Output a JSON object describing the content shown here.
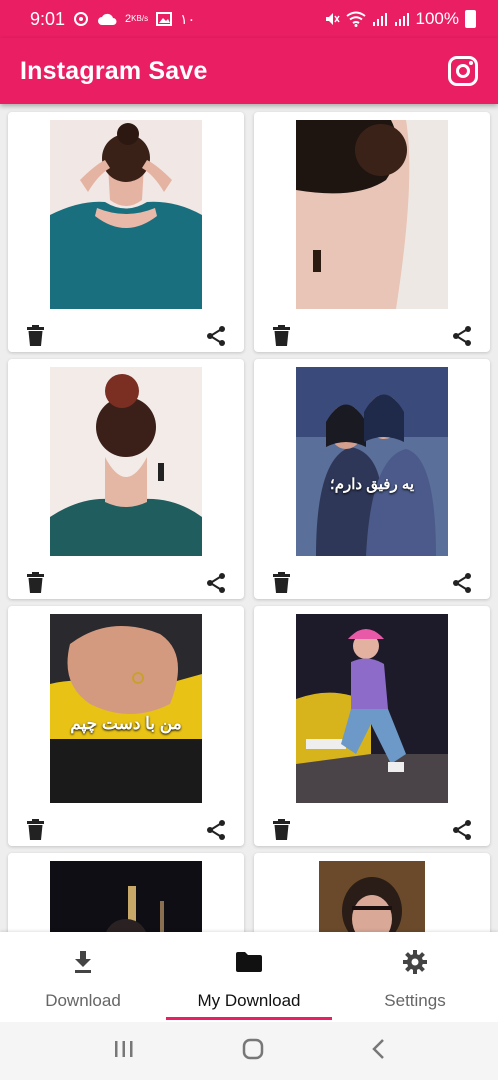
{
  "status_bar": {
    "time": "9:01",
    "data_speed": "2",
    "data_unit": "KB/s",
    "notification_count": "۱۰",
    "battery": "100%"
  },
  "app_bar": {
    "title": "Instagram Save",
    "icon": "instagram-icon"
  },
  "grid": {
    "cards": [
      {
        "image": "woman with hair bun wearing teal off-shoulder top, back view"
      },
      {
        "image": "close-up of woman neck with hair bun and earring"
      },
      {
        "image": "woman with red hair bun and teal top, back view"
      },
      {
        "image": "two women hugging",
        "overlay_title": "یه رفیق دارم؛"
      },
      {
        "image": "hands holding with ring",
        "overlay_title": "من با دست چپم"
      },
      {
        "image": "woman sitting by yellow car at night"
      },
      {
        "image": "night city tower"
      },
      {
        "image": "woman portrait"
      }
    ],
    "action_icons": {
      "delete": "trash-icon",
      "share": "share-icon"
    }
  },
  "bottom_nav": {
    "items": [
      {
        "label": "Download",
        "icon": "download-icon"
      },
      {
        "label": "My Download",
        "icon": "folder-icon",
        "active": true
      },
      {
        "label": "Settings",
        "icon": "gear-icon"
      }
    ]
  },
  "colors": {
    "primary": "#ea1e63",
    "background": "#eeeeee"
  }
}
